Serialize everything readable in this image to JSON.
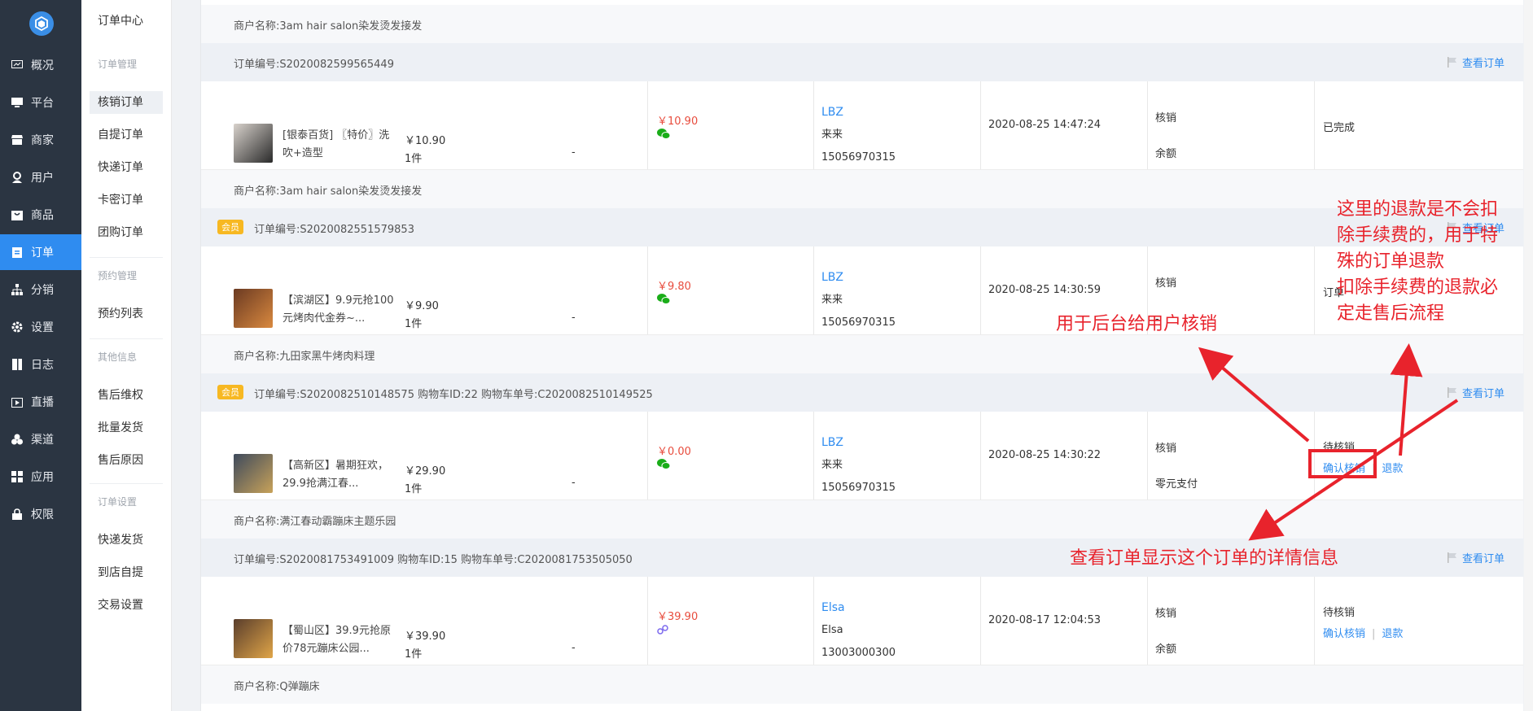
{
  "nav": {
    "items": [
      {
        "label": "概况",
        "icon": "dashboard-icon"
      },
      {
        "label": "平台",
        "icon": "monitor-icon"
      },
      {
        "label": "商家",
        "icon": "store-icon"
      },
      {
        "label": "用户",
        "icon": "user-icon"
      },
      {
        "label": "商品",
        "icon": "goods-icon"
      },
      {
        "label": "订单",
        "icon": "order-icon"
      },
      {
        "label": "分销",
        "icon": "distribution-icon"
      },
      {
        "label": "设置",
        "icon": "gear-icon"
      },
      {
        "label": "日志",
        "icon": "log-icon"
      },
      {
        "label": "直播",
        "icon": "live-icon"
      },
      {
        "label": "渠道",
        "icon": "channel-icon"
      },
      {
        "label": "应用",
        "icon": "apps-icon"
      },
      {
        "label": "权限",
        "icon": "lock-icon"
      }
    ],
    "active_index": 5
  },
  "subnav": {
    "title": "订单中心",
    "groups": [
      {
        "label": "订单管理",
        "items": [
          "核销订单",
          "自提订单",
          "快递订单",
          "卡密订单",
          "团购订单"
        ]
      },
      {
        "label": "预约管理",
        "items": [
          "预约列表"
        ]
      },
      {
        "label": "其他信息",
        "items": [
          "售后维权",
          "批量发货",
          "售后原因"
        ]
      },
      {
        "label": "订单设置",
        "items": [
          "快递发货",
          "到店自提",
          "交易设置"
        ]
      }
    ],
    "active_item": "核销订单"
  },
  "orders": {
    "top_merchant": "商户名称:3am hair salon染发烫发接发",
    "view_label": "查看订单",
    "list": [
      {
        "header": "订单编号:S2020082599565449",
        "member_badge": "",
        "product": "[银泰百货] 〖特价〗洗吹+造型",
        "price": "￥10.90",
        "qty": "1件",
        "dash": "-",
        "paid": "￥10.90",
        "pay_icon": "wechat-pay-icon",
        "user_name": "LBZ",
        "user_real": "来来",
        "phone": "15056970315",
        "time": "2020-08-25 14:47:24",
        "type": "核销",
        "pay_method": "余额",
        "status": "已完成",
        "actions": [],
        "merchant": "商户名称:3am hair salon染发烫发接发"
      },
      {
        "header": "订单编号:S2020082551579853",
        "member_badge": "会员",
        "product": "【滨湖区】9.9元抢100元烤肉代金券~...",
        "price": "￥9.90",
        "qty": "1件",
        "dash": "-",
        "paid": "￥9.80",
        "pay_icon": "wechat-pay-icon",
        "user_name": "LBZ",
        "user_real": "来来",
        "phone": "15056970315",
        "time": "2020-08-25 14:30:59",
        "type": "核销",
        "pay_method": "-",
        "status": "订单",
        "actions": [],
        "merchant": "商户名称:九田家黑牛烤肉料理"
      },
      {
        "header": "订单编号:S2020082510148575    购物车ID:22    购物车单号:C2020082510149525",
        "member_badge": "会员",
        "product": "【高新区】暑期狂欢，29.9抢满江春...",
        "price": "￥29.90",
        "qty": "1件",
        "dash": "-",
        "paid": "￥0.00",
        "pay_icon": "wechat-pay-icon",
        "user_name": "LBZ",
        "user_real": "来来",
        "phone": "15056970315",
        "time": "2020-08-25 14:30:22",
        "type": "核销",
        "pay_method": "零元支付",
        "status": "待核销",
        "actions": [
          "确认核销",
          "退款"
        ],
        "merchant": "商户名称:满江春动霸蹦床主题乐园"
      },
      {
        "header": "订单编号:S2020081753491009    购物车ID:15    购物车单号:C2020081753505050",
        "member_badge": "",
        "product": "【蜀山区】39.9元抢原价78元蹦床公园...",
        "price": "￥39.90",
        "qty": "1件",
        "dash": "-",
        "paid": "￥39.90",
        "pay_icon": "mini-program-icon",
        "user_name": "Elsa",
        "user_real": "Elsa",
        "phone": "13003000300",
        "time": "2020-08-17 12:04:53",
        "type": "核销",
        "pay_method": "余额",
        "status": "待核销",
        "actions": [
          "确认核销",
          "退款"
        ],
        "merchant": "商户名称:Q弹蹦床"
      }
    ]
  },
  "annotations": {
    "refund_note_lines": [
      "这里的退款是不会扣",
      "除手续费的，用于特",
      "殊的订单退款",
      "扣除手续费的退款必",
      "定走售后流程"
    ],
    "verify_note": "用于后台给用户核销",
    "view_note": "查看订单显示这个订单的详情信息",
    "color": "#e8232c"
  },
  "colors": {
    "accent": "#2f8cf0",
    "sidebar": "#2b3542",
    "badge": "#f7b822",
    "price_red": "#e84c3d"
  }
}
